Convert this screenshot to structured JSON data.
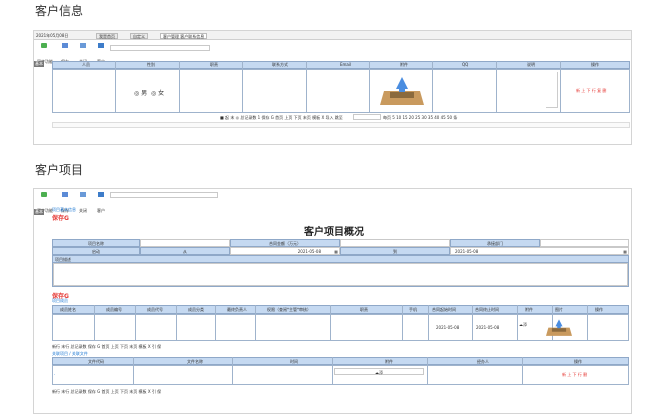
{
  "s1": {
    "title": "客户信息",
    "date": "2021年05月08日",
    "tabs": [
      "我是首页",
      "自定义",
      "客户管理 客户联系信息"
    ],
    "toolbar": [
      "同步功能",
      "保存",
      "关闭",
      "客户"
    ],
    "side": "基本",
    "headers": [
      "人员",
      "性别",
      "职责",
      "联系方式",
      "Email",
      "附件",
      "QQ",
      "说明",
      "操作"
    ],
    "gender_male": "男",
    "gender_female": "女",
    "action": "新 上 下 行 复 删",
    "pager_text": "■ 起 末 ◎ 总记录数 1 保存 G 首页 上页 下页 末页 模板 X 导入 跳至",
    "page_sizes": "每页 5 10 15 20 25 30 35 40 45 50 条"
  },
  "s2": {
    "title": "客户项目",
    "toolbar": [
      "同步功能",
      "保存",
      "关闭",
      "客户"
    ],
    "side": "基本",
    "link1": "项目基本信息",
    "save": "保存G",
    "page_title": "客户项目概况",
    "lbl_name": "项目名称",
    "lbl_amount": "合同金额（万元）",
    "lbl_dept": "承接部门",
    "lbl_start": "启动",
    "lbl_from": "从",
    "date_from": "2021-05-08",
    "lbl_to": "到",
    "date_to": "2021-05-08",
    "lbl_desc": "项目描述",
    "save2": "保存G",
    "link2": "项目成员",
    "members_headers": [
      "成员姓名",
      "成员编号",
      "成员代号",
      "成员分类",
      "最终负责人",
      "权限（查阅*主管*审核）",
      "职责",
      "手机",
      "合同起始时间",
      "合同终止时间",
      "附件",
      "图片",
      "操作"
    ],
    "member_date1": "2021-05-08",
    "member_date2": "2021-05-08",
    "attach": "添",
    "pager2": "新行 末行 总记录数 保存 G 首页 上页 下页 末页 模板 X 引 保",
    "link3": "关联项目 / 关联文件",
    "file_headers": [
      "文件代码",
      "文件名称",
      "时间",
      "附件",
      "经办人",
      "操作"
    ],
    "file_attach": "添",
    "file_action": "新 上 下 行 删",
    "pager3": "新行 末行 总记录数 保存 G 首页 上页 下页 末页 模板 X 引 保"
  }
}
